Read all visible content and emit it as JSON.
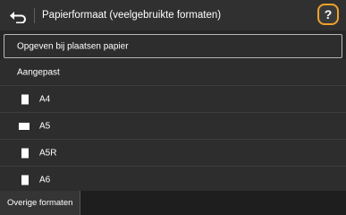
{
  "header": {
    "title": "Papierformaat (veelgebruikte formaten)",
    "help_label": "?"
  },
  "items": [
    {
      "label": "Opgeven bij plaatsen papier"
    },
    {
      "label": "Aangepast"
    },
    {
      "label": "A4",
      "icon": "portrait-paper-icon"
    },
    {
      "label": "A5",
      "icon": "landscape-paper-icon"
    },
    {
      "label": "A5R",
      "icon": "portrait-paper-icon"
    },
    {
      "label": "A6",
      "icon": "portrait-paper-icon"
    }
  ],
  "footer": {
    "other_sizes_label": "Overige formaten"
  },
  "colors": {
    "help_outline": "#f2a12a",
    "background": "#262626"
  }
}
